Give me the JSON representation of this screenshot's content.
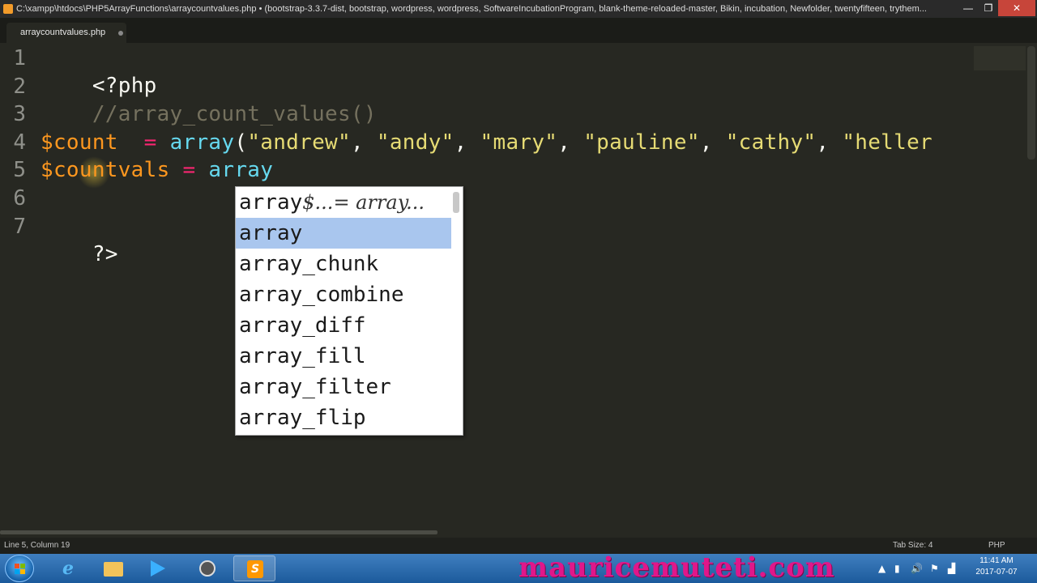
{
  "window": {
    "title": "C:\\xampp\\htdocs\\PHP5ArrayFunctions\\arraycountvalues.php • (bootstrap-3.3.7-dist, bootstrap, wordpress, wordpress, SoftwareIncubationProgram, blank-theme-reloaded-master, Bikin, incubation, Newfolder, twentyfifteen, trythem...",
    "minimize": "—",
    "maximize": "❐",
    "close": "✕"
  },
  "tab": {
    "label": "arraycountvalues.php"
  },
  "editor": {
    "line_numbers": [
      "1",
      "2",
      "3",
      "4",
      "5",
      "6",
      "7"
    ],
    "line1": "<?php",
    "line2": "//array_count_values()",
    "line4": {
      "var": "$count",
      "op": "  =",
      "func": " array",
      "open": "(",
      "s1": "\"andrew\"",
      "s2": "\"andy\"",
      "s3": "\"mary\"",
      "s4": "\"pauline\"",
      "s5": "\"cathy\"",
      "s6": "\"heller",
      "sep": ", "
    },
    "line5": {
      "var": "$countvals",
      "op": " =",
      "text": " array"
    },
    "line7": "?>"
  },
  "autocomplete": {
    "items": [
      {
        "label": "array",
        "hint": "$...= array..."
      },
      {
        "label": "array",
        "hint": ""
      },
      {
        "label": "array_chunk",
        "hint": ""
      },
      {
        "label": "array_combine",
        "hint": ""
      },
      {
        "label": "array_diff",
        "hint": ""
      },
      {
        "label": "array_fill",
        "hint": ""
      },
      {
        "label": "array_filter",
        "hint": ""
      },
      {
        "label": "array_flip",
        "hint": ""
      }
    ],
    "selected_index": 1
  },
  "status": {
    "position": "Line 5, Column 19",
    "tab_size": "Tab Size: 4",
    "syntax": "PHP"
  },
  "taskbar": {
    "watermark": "mauricemuteti.com",
    "ie_glyph": "e",
    "sublime_glyph": "S",
    "tray_icons": [
      "up-arrow-icon",
      "battery-icon",
      "volume-icon",
      "flag-icon",
      "network-icon"
    ],
    "tray": {
      "up": "▲",
      "battery": "▮",
      "volume": "🔊",
      "flag": "⚑",
      "signal": "▟"
    },
    "time": "11:41 AM",
    "date": "2017-07-07"
  },
  "colors": {
    "background": "#272822",
    "comment": "#75715e",
    "variable": "#fd971f",
    "operator": "#f92672",
    "function": "#66d9ef",
    "string": "#e6db74",
    "selection": "#a9c6ee"
  }
}
